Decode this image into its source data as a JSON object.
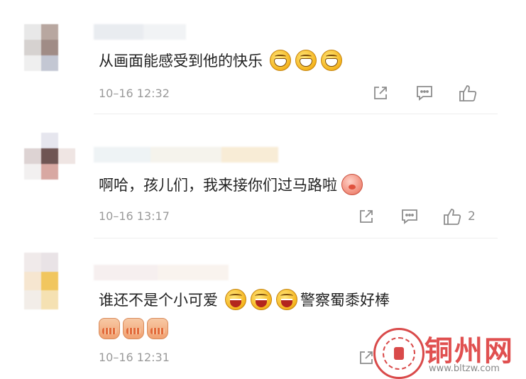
{
  "comments": [
    {
      "text": "从画面能感受到他的快乐",
      "emojis": [
        "grin-emoji",
        "grin-emoji",
        "grin-emoji"
      ],
      "time": "10–16 12:32",
      "like_count": ""
    },
    {
      "text": "啊哈，孩儿们，我来接你们过马路啦",
      "emojis": [
        "piggy-emoji"
      ],
      "time": "10–16 13:17",
      "like_count": "2"
    },
    {
      "text_before": "谁还不是个小可爱",
      "emojis": [
        "laugh-emoji",
        "laugh-emoji",
        "laugh-emoji"
      ],
      "text_after": "警察蜀黍好棒",
      "line2_emojis": [
        "clap-hands-emoji",
        "clap-hands-emoji",
        "clap-hands-emoji"
      ],
      "time": "10–16 12:31",
      "like_count": ""
    }
  ],
  "watermark": {
    "title": "铜州网",
    "url": "www.bltzw.com"
  }
}
